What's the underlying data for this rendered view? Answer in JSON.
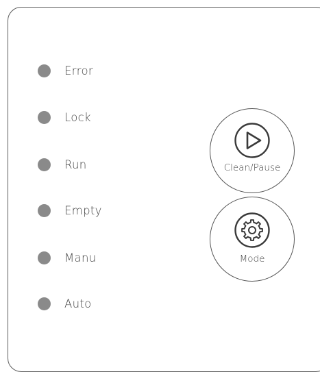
{
  "indicators": [
    {
      "label": "Error"
    },
    {
      "label": "Lock"
    },
    {
      "label": "Run"
    },
    {
      "label": "Empty"
    },
    {
      "label": "Manu"
    },
    {
      "label": "Auto"
    }
  ],
  "buttons": {
    "clean_pause": {
      "label": "Clean/Pause",
      "icon": "play-icon"
    },
    "mode": {
      "label": "Mode",
      "icon": "gear-icon"
    }
  },
  "colors": {
    "led": "#8a8a8a",
    "border": "#5a5a5a",
    "text": "#454545",
    "background": "#ffffff"
  }
}
